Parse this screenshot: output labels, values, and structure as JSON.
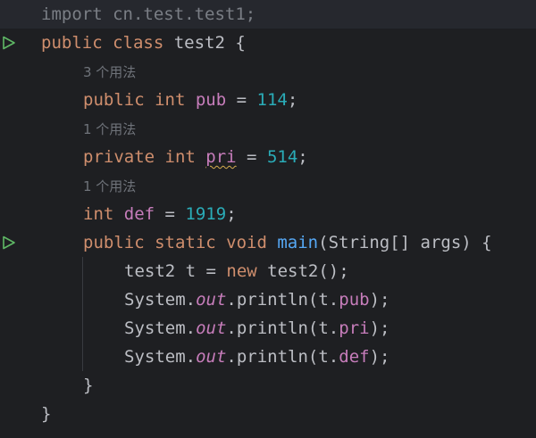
{
  "editor": {
    "lines": [
      {
        "id": "import",
        "tokens": [
          {
            "t": "import cn.test.test1;",
            "c": "dim"
          }
        ]
      },
      {
        "id": "class-decl",
        "tokens": [
          {
            "t": "public ",
            "c": "kw"
          },
          {
            "t": "class ",
            "c": "kw"
          },
          {
            "t": "test2 {",
            "c": "plain"
          }
        ]
      },
      {
        "id": "hint-pub",
        "hint": "3 个用法"
      },
      {
        "id": "field-pub",
        "tokens": [
          {
            "t": "public ",
            "c": "kw"
          },
          {
            "t": "int ",
            "c": "kw"
          },
          {
            "t": "pub",
            "c": "fld"
          },
          {
            "t": " = ",
            "c": "plain"
          },
          {
            "t": "114",
            "c": "num"
          },
          {
            "t": ";",
            "c": "plain"
          }
        ]
      },
      {
        "id": "hint-pri",
        "hint": "1 个用法"
      },
      {
        "id": "field-pri",
        "tokens": [
          {
            "t": "private ",
            "c": "kw"
          },
          {
            "t": "int ",
            "c": "kw"
          },
          {
            "t": "pri",
            "c": "fld warn"
          },
          {
            "t": " = ",
            "c": "plain"
          },
          {
            "t": "514",
            "c": "num"
          },
          {
            "t": ";",
            "c": "plain"
          }
        ]
      },
      {
        "id": "hint-def",
        "hint": "1 个用法"
      },
      {
        "id": "field-def",
        "tokens": [
          {
            "t": "int ",
            "c": "kw"
          },
          {
            "t": "def",
            "c": "fld"
          },
          {
            "t": " = ",
            "c": "plain"
          },
          {
            "t": "1919",
            "c": "num"
          },
          {
            "t": ";",
            "c": "plain"
          }
        ]
      },
      {
        "id": "main-decl",
        "tokens": [
          {
            "t": "public ",
            "c": "kw"
          },
          {
            "t": "static ",
            "c": "kw"
          },
          {
            "t": "void ",
            "c": "kw"
          },
          {
            "t": "main",
            "c": "fn"
          },
          {
            "t": "(String[] args) {",
            "c": "plain"
          }
        ]
      },
      {
        "id": "stmt-new",
        "tokens": [
          {
            "t": "test2 t = ",
            "c": "plain"
          },
          {
            "t": "new ",
            "c": "kw"
          },
          {
            "t": "test2();",
            "c": "plain"
          }
        ]
      },
      {
        "id": "stmt-print-pub",
        "tokens": [
          {
            "t": "System.",
            "c": "plain"
          },
          {
            "t": "out",
            "c": "stat"
          },
          {
            "t": ".println(t.",
            "c": "plain"
          },
          {
            "t": "pub",
            "c": "fld"
          },
          {
            "t": ");",
            "c": "plain"
          }
        ]
      },
      {
        "id": "stmt-print-pri",
        "tokens": [
          {
            "t": "System.",
            "c": "plain"
          },
          {
            "t": "out",
            "c": "stat"
          },
          {
            "t": ".println(t.",
            "c": "plain"
          },
          {
            "t": "pri",
            "c": "fld"
          },
          {
            "t": ");",
            "c": "plain"
          }
        ]
      },
      {
        "id": "stmt-print-def",
        "tokens": [
          {
            "t": "System.",
            "c": "plain"
          },
          {
            "t": "out",
            "c": "stat"
          },
          {
            "t": ".println(t.",
            "c": "plain"
          },
          {
            "t": "def",
            "c": "fld"
          },
          {
            "t": ");",
            "c": "plain"
          }
        ]
      },
      {
        "id": "main-close",
        "tokens": [
          {
            "t": "}",
            "c": "plain"
          }
        ]
      },
      {
        "id": "class-close",
        "tokens": [
          {
            "t": "}",
            "c": "plain"
          }
        ]
      }
    ]
  },
  "colors": {
    "background": "#1e1f22",
    "keyword": "#cf8e6d",
    "number": "#2aacb8",
    "field": "#c77dbb",
    "method": "#56a8f5",
    "text": "#bcbec4",
    "hint": "#6f737a",
    "run_icon": "#5fb865"
  },
  "gutter_icons": [
    {
      "line": "class-decl",
      "icon": "run-icon"
    },
    {
      "line": "main-decl",
      "icon": "run-icon"
    }
  ]
}
